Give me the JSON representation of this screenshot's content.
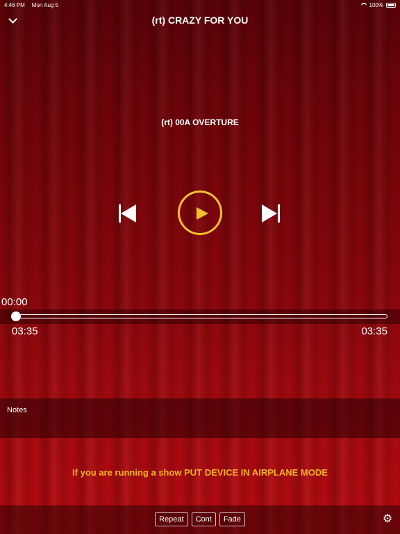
{
  "status_bar": {
    "time": "4:46 PM",
    "date": "Mon Aug 5",
    "battery": "100%"
  },
  "header": {
    "title": "(rt) CRAZY FOR YOU",
    "back_icon": "chevron-down-icon"
  },
  "track": {
    "name": "(rt) 00A OVERTURE"
  },
  "player": {
    "prev_icon": "skip-back-icon",
    "play_icon": "play-icon",
    "next_icon": "skip-forward-icon",
    "current_time": "00:00",
    "elapsed_label": "03:35",
    "total_label": "03:35",
    "progress_fraction": 0,
    "accent_color": "#f2c12e"
  },
  "notes": {
    "label": "Notes"
  },
  "message": {
    "text": "If you are running a show PUT DEVICE IN AIRPLANE MODE",
    "color": "#f2b51f"
  },
  "bottom_bar": {
    "buttons": [
      {
        "label": "Repeat"
      },
      {
        "label": "Cont"
      },
      {
        "label": "Fade"
      }
    ],
    "settings_icon": "gear-icon"
  },
  "colors": {
    "background_top": "#5a0307",
    "background_bottom": "#b30b10"
  }
}
